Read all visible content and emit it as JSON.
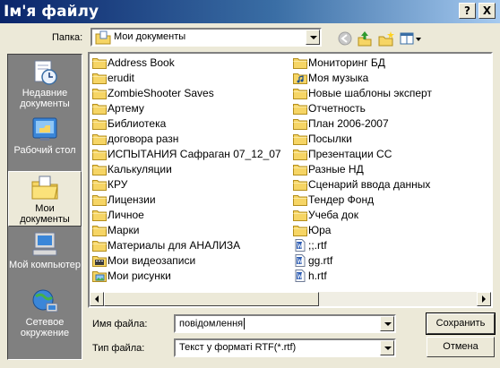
{
  "window": {
    "title": "Ім'я файлу",
    "help_label": "?",
    "close_label": "X"
  },
  "lookin": {
    "label": "Папка:",
    "value": "Мои документы"
  },
  "places": [
    {
      "label": "Недавние документы",
      "icon": "recent-documents-icon"
    },
    {
      "label": "Рабочий стол",
      "icon": "desktop-icon"
    },
    {
      "label": "Мои документы",
      "icon": "my-documents-icon",
      "selected": true
    },
    {
      "label": "Мой компьютер",
      "icon": "my-computer-icon"
    },
    {
      "label": "Сетевое окружение",
      "icon": "network-icon"
    }
  ],
  "files": {
    "col1": [
      {
        "name": "Address Book",
        "type": "folder"
      },
      {
        "name": "erudit",
        "type": "folder"
      },
      {
        "name": "ZombieShooter Saves",
        "type": "folder"
      },
      {
        "name": "Артему",
        "type": "folder"
      },
      {
        "name": "Библиотека",
        "type": "folder"
      },
      {
        "name": "договора разн",
        "type": "folder"
      },
      {
        "name": "ИСПЫТАНИЯ Сафраган 07_12_07",
        "type": "folder"
      },
      {
        "name": "Калькуляции",
        "type": "folder"
      },
      {
        "name": "КРУ",
        "type": "folder"
      },
      {
        "name": "Лицензии",
        "type": "folder"
      },
      {
        "name": "Личное",
        "type": "folder"
      },
      {
        "name": "Марки",
        "type": "folder"
      },
      {
        "name": "Материалы для АНАЛИЗА",
        "type": "folder"
      },
      {
        "name": "Мои видеозаписи",
        "type": "video-folder"
      },
      {
        "name": "Мои рисунки",
        "type": "pictures-folder"
      }
    ],
    "col2": [
      {
        "name": "Мониторинг БД",
        "type": "folder"
      },
      {
        "name": "Моя музыка",
        "type": "music-folder"
      },
      {
        "name": "Новые шаблоны эксперт",
        "type": "folder"
      },
      {
        "name": "Отчетность",
        "type": "folder"
      },
      {
        "name": "План 2006-2007",
        "type": "folder"
      },
      {
        "name": "Посылки",
        "type": "folder"
      },
      {
        "name": "Презентации СС",
        "type": "folder"
      },
      {
        "name": "Разные НД",
        "type": "folder"
      },
      {
        "name": "Сценарий ввода данных",
        "type": "folder"
      },
      {
        "name": "Тендер Фонд",
        "type": "folder"
      },
      {
        "name": "Учеба док",
        "type": "folder"
      },
      {
        "name": "Юра",
        "type": "folder"
      },
      {
        "name": ";;.rtf",
        "type": "rtf"
      },
      {
        "name": "gg.rtf",
        "type": "rtf"
      },
      {
        "name": "h.rtf",
        "type": "rtf"
      }
    ]
  },
  "filename": {
    "label": "Имя файла:",
    "value": "повідомлення"
  },
  "filetype": {
    "label": "Тип файла:",
    "value": "Текст у форматі RTF(*.rtf)"
  },
  "buttons": {
    "save": "Сохранить",
    "cancel": "Отмена"
  },
  "colors": {
    "title_start": "#0a246a",
    "title_end": "#a6caf0",
    "dialog_bg": "#ece9d8",
    "places_bg": "#808080",
    "folder": "#f6d565"
  }
}
